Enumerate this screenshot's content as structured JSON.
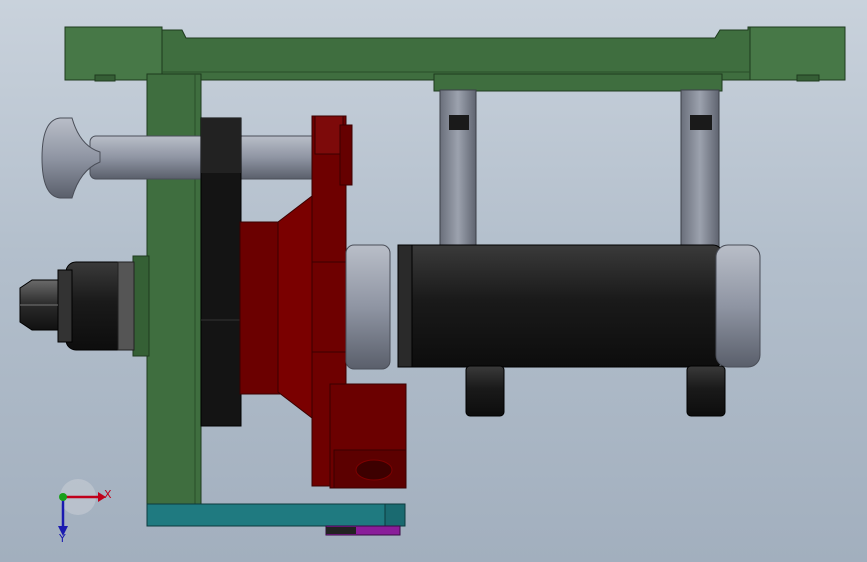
{
  "viewport": {
    "background_top": "#c9d2dc",
    "background_bottom": "#a2afbe"
  },
  "model": {
    "colors": {
      "frame": "#3f6e3f",
      "frame_dark": "#274a27",
      "caliper": "#6b0000",
      "caliper_dark": "#4a0000",
      "steel": "#8f95a3",
      "steel_dark": "#5a5f6b",
      "black_part": "#1b1b1b",
      "teal_plate": "#1f7a80",
      "purple_part": "#8a1d9a"
    }
  },
  "triad": {
    "x_label": "X",
    "y_label": "Y",
    "x_color": "#c0001a",
    "y_color": "#1aa01a",
    "z_color": "#1a1ab0"
  }
}
